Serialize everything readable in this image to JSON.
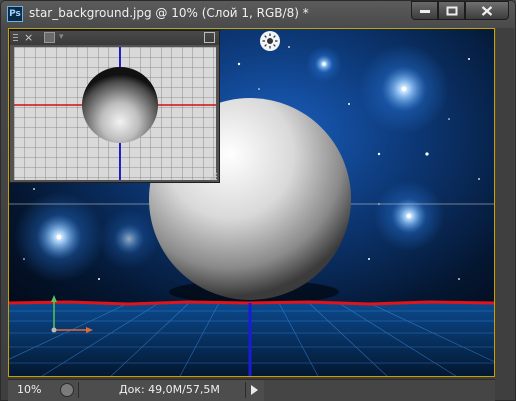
{
  "app": {
    "logo_text": "Ps",
    "document_title": "star_background.jpg @ 10% (Слой 1, RGB/8) *"
  },
  "window_controls": [
    {
      "name": "minimize-button",
      "icon": "minimize-icon"
    },
    {
      "name": "maximize-button",
      "icon": "maximize-icon"
    },
    {
      "name": "close-button",
      "icon": "close-icon"
    }
  ],
  "navigator_panel": {
    "close_label": "×",
    "menu_caret": "▾",
    "icons": [
      "panel-grip-icon",
      "close-icon",
      "add-layer-icon",
      "expand-icon",
      "resize-grip-icon"
    ]
  },
  "statusbar": {
    "zoom": "10%",
    "doc_info": "Док: 49,0M/57,5M",
    "icons": [
      "status-menu-icon",
      "play-arrow-icon"
    ]
  },
  "colors": {
    "active_frame": "#c8a000",
    "horizon_line": "#e0141a",
    "vertical_axis": "#1a1ad8",
    "space": "#041630",
    "glow": "#2a7be0"
  }
}
